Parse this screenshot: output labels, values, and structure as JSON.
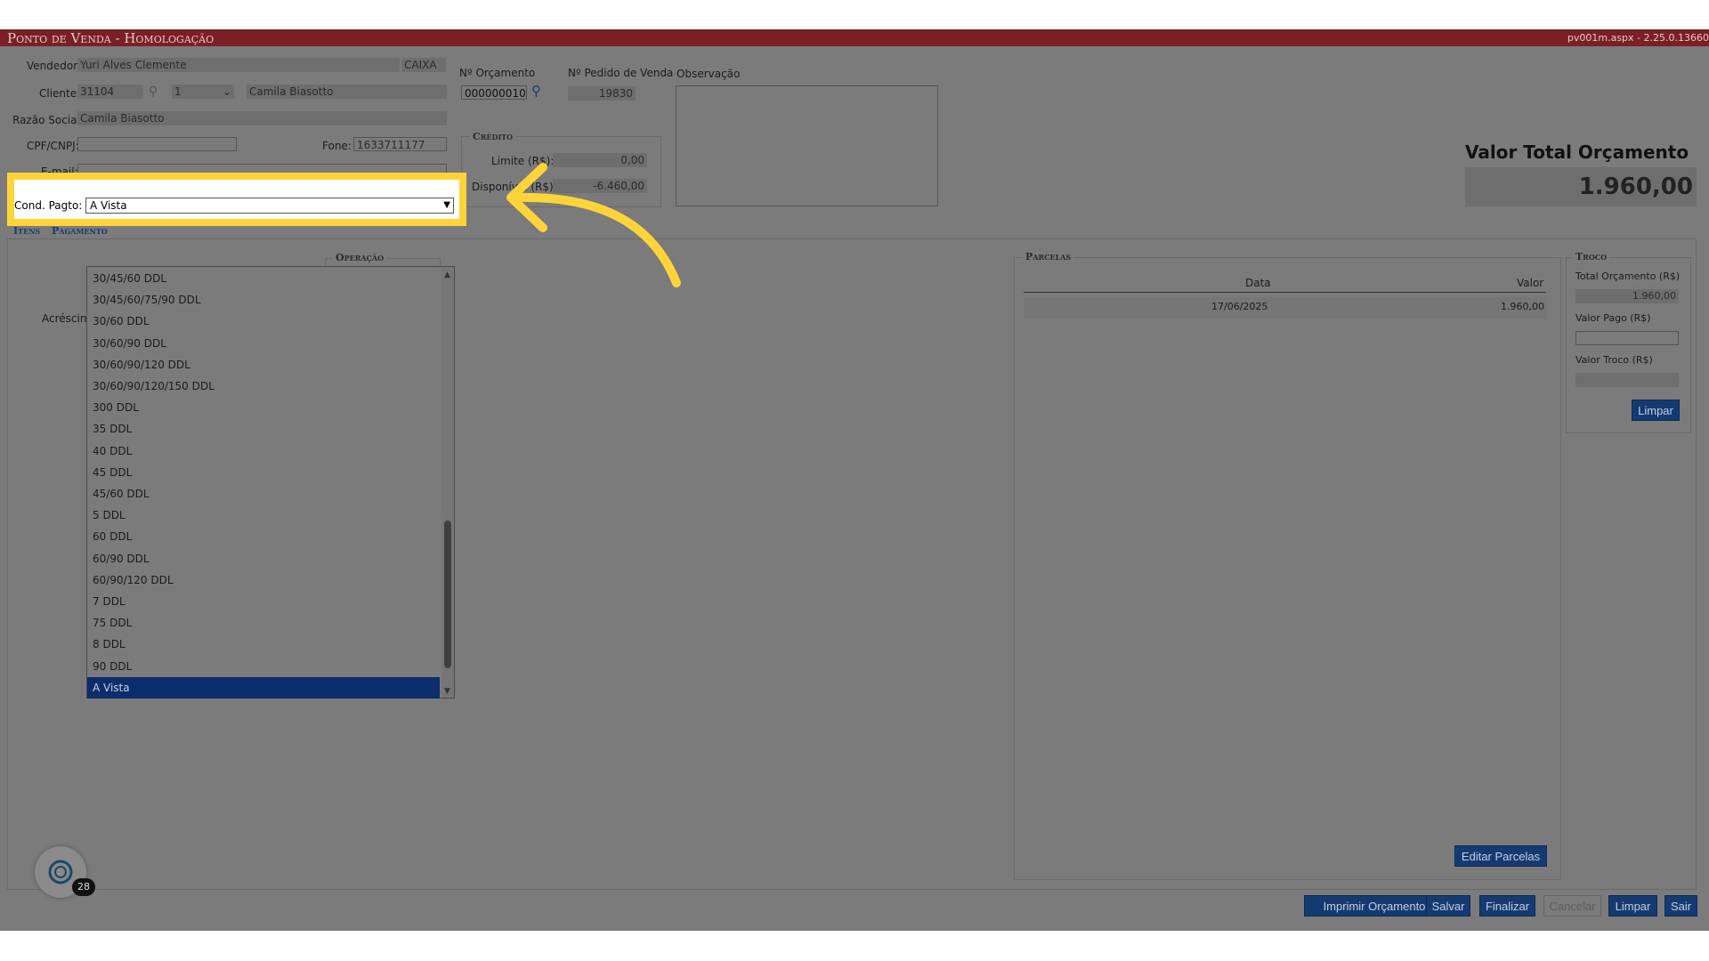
{
  "titlebar": {
    "title": "Ponto de Venda  - Homologação",
    "version": "pv001m.aspx - 2.25.0.13660"
  },
  "header": {
    "vendedor_label": "Vendedor:",
    "vendedor_value": "Yuri Alves Clemente",
    "caixa": "CAIXA",
    "cliente_label": "Cliente:",
    "cliente_code": "31104",
    "cliente_seq": "1",
    "cliente_name": "Camila Biasotto",
    "razao_label": "Razão Social:",
    "razao_value": "Camila Biasotto",
    "cpf_label": "CPF/CNPJ:",
    "cpf_value": "",
    "fone_label": "Fone:",
    "fone_value": "1633711177",
    "email_label": "E-mail:",
    "orcamento_label": "Nº Orçamento",
    "orcamento_value": "000000010",
    "pedido_label": "Nº Pedido de Venda",
    "pedido_value": "19830",
    "observacao_label": "Observação",
    "credito_title": "Crédito",
    "limite_label": "Limite (R$):",
    "limite_value": "0,00",
    "disponivel_label": "Disponível (R$):",
    "disponivel_value": "-6.460,00",
    "valor_total_label": "Valor Total Orçamento",
    "valor_total_value": "1.960,00"
  },
  "cond_pagto": {
    "label": "Cond. Pagto:",
    "selected": "A Vista"
  },
  "tabs": [
    {
      "label": "Itens"
    },
    {
      "label": "Pagamento"
    }
  ],
  "operacao": {
    "title": "Operação",
    "acrescimo_label": "Acréscimo"
  },
  "dropdown_options": [
    "30/45/60 DDL",
    "30/45/60/75/90 DDL",
    "30/60 DDL",
    "30/60/90 DDL",
    "30/60/90/120 DDL",
    "30/60/90/120/150 DDL",
    "300 DDL",
    "35 DDL",
    "40 DDL",
    "45 DDL",
    "45/60 DDL",
    "5 DDL",
    "60 DDL",
    "60/90 DDL",
    "60/90/120 DDL",
    "7 DDL",
    "75 DDL",
    "8 DDL",
    "90 DDL",
    "A Vista"
  ],
  "parcelas": {
    "title": "Parcelas",
    "col_data": "Data",
    "col_valor": "Valor",
    "rows": [
      {
        "data": "17/06/2025",
        "valor": "1.960,00"
      }
    ],
    "edit_button": "Editar Parcelas"
  },
  "troco": {
    "title": "Troco",
    "total_label": "Total Orçamento (R$)",
    "total_value": "1.960,00",
    "pago_label": "Valor Pago (R$)",
    "pago_value": "",
    "troco_label": "Valor Troco (R$)",
    "troco_value": "",
    "limpar_button": "Limpar"
  },
  "footer_buttons": {
    "imprimir": "Imprimir Orçamento",
    "salvar": "Salvar",
    "finalizar": "Finalizar",
    "cancelar": "Cancelar",
    "limpar": "Limpar",
    "sair": "Sair"
  },
  "widget": {
    "badge": "28"
  },
  "colors": {
    "titlebar": "#7a1f26",
    "highlight": "#ffd43b",
    "selection": "#0d2c6b",
    "button": "#153a72"
  }
}
